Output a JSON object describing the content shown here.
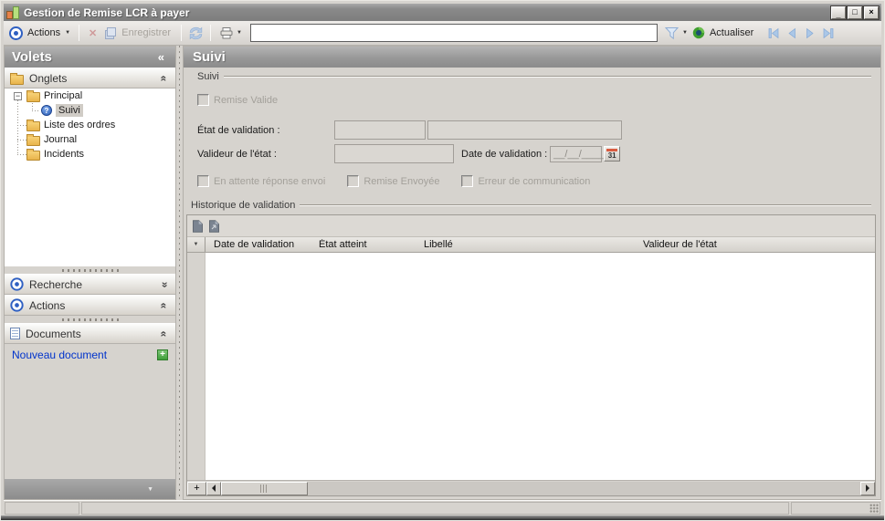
{
  "window": {
    "title": "Gestion de Remise LCR à payer",
    "minimize_glyph": "_",
    "maximize_glyph": "□",
    "close_glyph": "×"
  },
  "toolbar": {
    "actions_label": "Actions",
    "delete_glyph": "✕",
    "enregistrer_label": "Enregistrer",
    "search_value": "",
    "actualiser_label": "Actualiser"
  },
  "icons": {
    "app_icon": "bar-chart",
    "actions_icon": "bullseye",
    "delete_icon": "red-x",
    "save_icon": "save-pages",
    "sync_icon": "refresh-arrows",
    "print_icon": "printer",
    "filter_icon": "funnel",
    "refresh_icon": "green-refresh",
    "nav_first_icon": "first-record",
    "nav_prev_icon": "previous-record",
    "nav_next_icon": "next-record",
    "nav_last_icon": "last-record",
    "collapse_left_glyph": "«",
    "chevron_double_glyph": "«",
    "expander_open_glyph": "−",
    "dropdown_caret_glyph": "▼"
  },
  "sidebar": {
    "title": "Volets",
    "sections": {
      "onglets": {
        "label": "Onglets"
      },
      "recherche": {
        "label": "Recherche"
      },
      "actions": {
        "label": "Actions"
      },
      "documents": {
        "label": "Documents"
      }
    },
    "tree": {
      "root": {
        "label": "Principal"
      },
      "child": {
        "label": "Suivi",
        "selected": true
      },
      "siblings": [
        {
          "label": "Liste des ordres"
        },
        {
          "label": "Journal"
        },
        {
          "label": "Incidents"
        }
      ]
    },
    "new_document_label": "Nouveau document"
  },
  "main": {
    "title": "Suivi",
    "suivi_group": {
      "label": "Suivi",
      "remise_valide_label": "Remise Valide",
      "etat_validation_label": "État de validation :",
      "etat_value_code": "",
      "etat_value_text": "",
      "valideur_label": "Valideur de l'état :",
      "valideur_value": "",
      "date_validation_label": "Date de validation :",
      "date_mask": "__/__/____",
      "calendar_day": "31",
      "cb_attente_label": "En attente réponse envoi",
      "cb_envoyee_label": "Remise Envoyée",
      "cb_erreur_label": "Erreur de communication"
    },
    "historique_group": {
      "label": "Historique de validation",
      "table": {
        "indicator_glyph": "▼",
        "columns": [
          "Date de validation",
          "État atteint",
          "Libellé",
          "Valideur de l'état"
        ],
        "rows": []
      },
      "add_row_glyph": "+"
    }
  },
  "colors": {
    "titlebar": "#838383",
    "window_face": "#d6d3ce",
    "panel_header_text": "#ffffff",
    "link": "#0033cc",
    "accent_blue": "#2e5fc2",
    "disabled_text": "#a3a09a",
    "selection": "#d0ccc6"
  }
}
